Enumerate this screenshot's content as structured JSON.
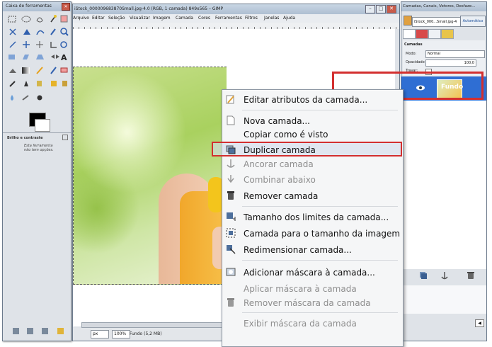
{
  "toolbox": {
    "title": "Caixa de ferramentas",
    "options_title": "Brilho e contraste",
    "options_text": "Esta ferramenta não tem opções."
  },
  "main": {
    "title": "iStock_000009683870Small.jpg-4.0 (RGB, 1 camada) 849x565 – GIMP",
    "menu": [
      "Arquivo",
      "Editar",
      "Seleção",
      "Visualizar",
      "Imagem",
      "Camada",
      "Cores",
      "Ferramentas",
      "Filtros",
      "Janelas",
      "Ajuda"
    ],
    "status": {
      "unit": "px",
      "zoom": "100%",
      "layer_info": "Fundo (5,2 MB)"
    }
  },
  "dock": {
    "title": "Camadas, Canais, Vetores, Desfaze...",
    "image_select": "iStock_000...Small.jpg-4",
    "auto_button": "Automático",
    "panel_title": "Camadas",
    "mode_label": "Modo:",
    "mode_value": "Normal",
    "opacity_label": "Opacidade",
    "opacity_value": "100,0",
    "lock_label": "Travar:",
    "layer_name": "Fundo"
  },
  "context_menu": {
    "items": [
      {
        "label": "Editar atributos da camada...",
        "icon": "edit-attributes-icon",
        "disabled": false
      },
      {
        "label": "Nova camada...",
        "icon": "new-layer-icon",
        "disabled": false
      },
      {
        "label": "Copiar como é visto",
        "icon": "",
        "disabled": false
      },
      {
        "label": "Duplicar camada",
        "icon": "duplicate-layer-icon",
        "disabled": false,
        "highlighted": true
      },
      {
        "label": "Ancorar camada",
        "icon": "anchor-icon",
        "disabled": true
      },
      {
        "label": "Combinar abaixo",
        "icon": "merge-down-icon",
        "disabled": true
      },
      {
        "label": "Remover camada",
        "icon": "trash-icon",
        "disabled": false
      },
      {
        "label": "Tamanho dos limites da camada...",
        "icon": "layer-boundary-icon",
        "disabled": false
      },
      {
        "label": "Camada para o tamanho da imagem",
        "icon": "layer-to-image-size-icon",
        "disabled": false
      },
      {
        "label": "Redimensionar camada...",
        "icon": "scale-layer-icon",
        "disabled": false
      },
      {
        "label": "Adicionar máscara à camada...",
        "icon": "add-mask-icon",
        "disabled": false
      },
      {
        "label": "Aplicar máscara à camada",
        "icon": "",
        "disabled": true
      },
      {
        "label": "Remover máscara da camada",
        "icon": "trash-icon",
        "disabled": true
      },
      {
        "label": "Exibir máscara da camada",
        "icon": "",
        "disabled": true
      }
    ]
  },
  "colors": {
    "highlight": "#d32f2f",
    "layer_selected": "#2f6ed3"
  }
}
